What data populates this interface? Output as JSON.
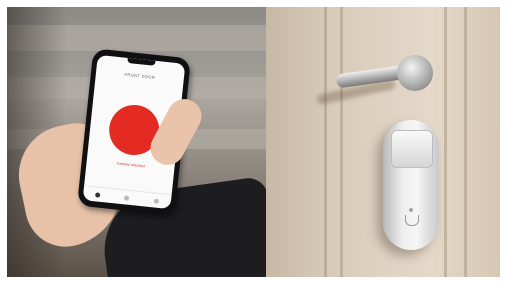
{
  "phone_app": {
    "screen_title": "FRONT DOOR",
    "status_text": "Tuesday unlocked",
    "lock_button_color": "#e32a23"
  },
  "scene": {
    "left_photo": "hand-holding-phone-with-lock-app",
    "right_photo": "door-with-lever-handle-and-smart-lock"
  }
}
